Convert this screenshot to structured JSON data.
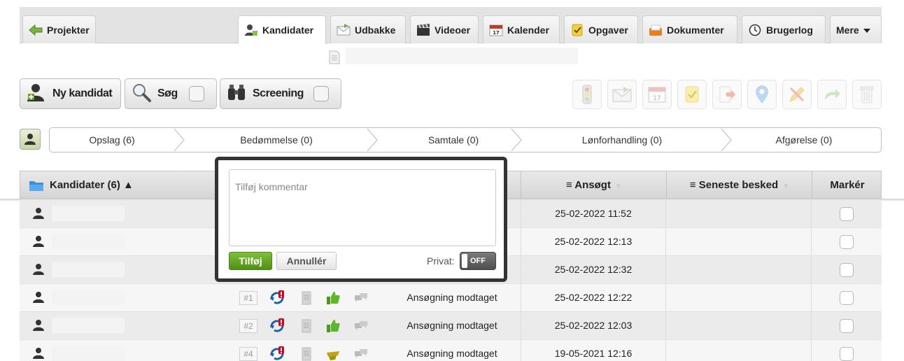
{
  "topbar": {
    "back_tab": "Projekter",
    "tabs": [
      {
        "label": "Kandidater",
        "icon": "person-icon",
        "active": true
      },
      {
        "label": "Udbakke",
        "icon": "envelope-icon"
      },
      {
        "label": "Videoer",
        "icon": "clapperboard-icon"
      },
      {
        "label": "Kalender",
        "icon": "calendar-icon"
      },
      {
        "label": "Opgaver",
        "icon": "checkmark-note-icon"
      },
      {
        "label": "Dokumenter",
        "icon": "folder-icon"
      },
      {
        "label": "Brugerlog",
        "icon": "clock-icon"
      },
      {
        "label": "Mere",
        "icon": "dropdown-caret-icon"
      }
    ]
  },
  "toolbar": {
    "new_candidate": "Ny kandidat",
    "search": "Søg",
    "screening": "Screening",
    "right_tools": [
      "traffic-light-icon",
      "mail-icon",
      "calendar-icon",
      "task-icon",
      "export-icon",
      "pin-icon",
      "edit-pencil-icon",
      "redo-icon",
      "trash-icon"
    ]
  },
  "pipeline": {
    "stages": [
      "Opslag (6)",
      "Bedømmelse (0)",
      "Samtale (0)",
      "Lønforhandling (0)",
      "Afgørelse (0)"
    ]
  },
  "table": {
    "col_candidates": "Kandidater (6) ▲",
    "col_applied": "≡ Ansøgt",
    "col_latest": "≡ Seneste besked",
    "col_mark": "Markér",
    "rows": [
      {
        "num": "",
        "status": "",
        "date": "25-02-2022 11:52",
        "thumb": ""
      },
      {
        "num": "",
        "status": "",
        "date": "25-02-2022 12:13",
        "thumb": ""
      },
      {
        "num": "",
        "status": "",
        "date": "25-02-2022 12:32",
        "thumb": ""
      },
      {
        "num": "#1",
        "status": "Ansøgning modtaget",
        "date": "25-02-2022 12:22",
        "thumb": "up"
      },
      {
        "num": "#2",
        "status": "Ansøgning modtaget",
        "date": "25-02-2022 12:03",
        "thumb": "up"
      },
      {
        "num": "#4",
        "status": "Ansøgning modtaget",
        "date": "19-05-2021 12:16",
        "thumb": "down"
      }
    ]
  },
  "popup": {
    "placeholder": "Tilføj kommentar",
    "add_label": "Tilføj",
    "cancel_label": "Annullér",
    "private_label": "Privat:",
    "toggle_label": "OFF"
  },
  "colors": {
    "accent_green": "#5aa01e",
    "refresh_blue": "#1f5fa8",
    "badge_red": "#d8001b"
  }
}
